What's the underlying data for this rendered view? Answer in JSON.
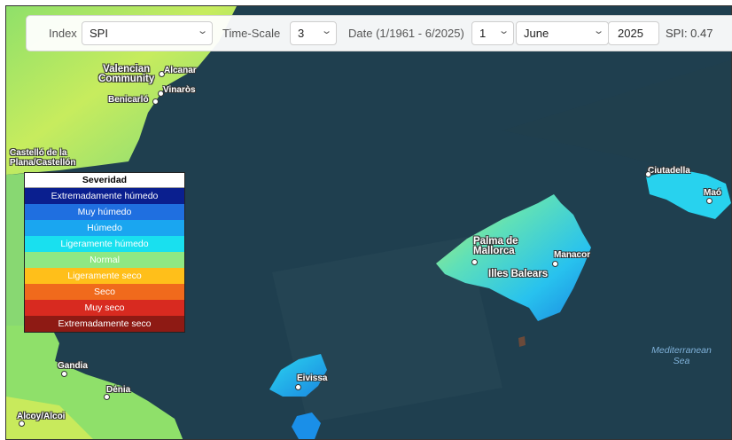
{
  "controls": {
    "index_label": "Index",
    "index_value": "SPI",
    "timescale_label": "Time-Scale",
    "timescale_value": "3",
    "date_label": "Date (1/1961 - 6/2025)",
    "day_value": "1",
    "month_value": "June",
    "year_value": "2025",
    "spi_readout": "SPI: 0.47"
  },
  "legend": {
    "title": "Severidad",
    "items": [
      {
        "label": "Extremadamente húmedo",
        "color": "#0a1f8f"
      },
      {
        "label": "Muy húmedo",
        "color": "#1f6fe0"
      },
      {
        "label": "Húmedo",
        "color": "#1aa6f0"
      },
      {
        "label": "Ligeramente húmedo",
        "color": "#19e0ef"
      },
      {
        "label": "Normal",
        "color": "#8fe883"
      },
      {
        "label": "Ligeramente seco",
        "color": "#ffbf1a"
      },
      {
        "label": "Seco",
        "color": "#f06a1c"
      },
      {
        "label": "Muy seco",
        "color": "#d82a20"
      },
      {
        "label": "Extremadamente seco",
        "color": "#8e1a14"
      }
    ]
  },
  "places": {
    "valencian": "Valencian\nCommunity",
    "alcanar": "Alcanar",
    "vinaros": "Vinaròs",
    "benicarlo": "Benicarló",
    "castello": "Castelló de la\nPlana/Castellón",
    "ciutadella": "Ciutadella",
    "mao": "Maó",
    "palma": "Palma de\nMallorca",
    "manacor": "Manacor",
    "illes": "Illes Balears",
    "gandia": "Gandia",
    "denia": "Dénia",
    "alcoy": "Alcoy/Alcoi",
    "eivissa": "Eivissa",
    "sea": "Mediterranean\nSea"
  }
}
